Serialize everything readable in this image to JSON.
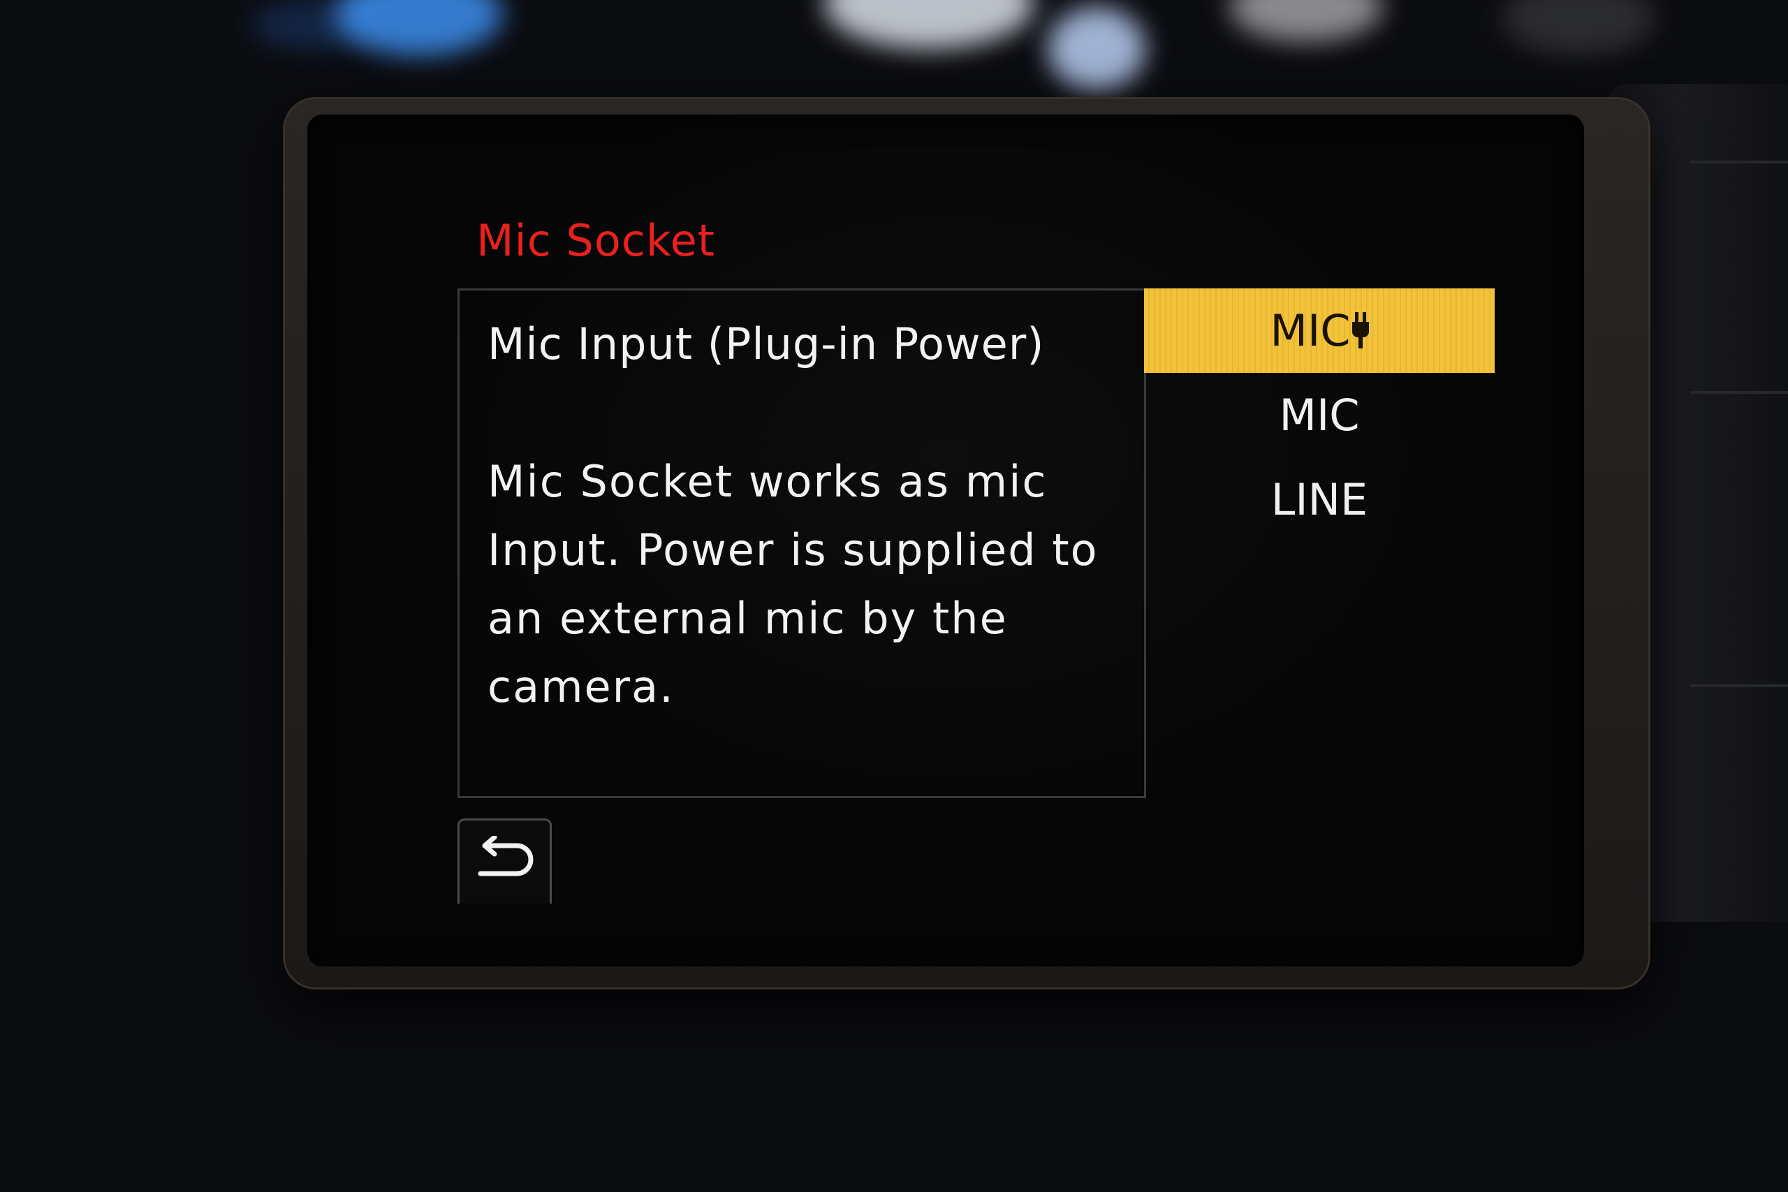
{
  "menu": {
    "title": "Mic Socket",
    "title_color": "#e8201e"
  },
  "description": {
    "heading": "Mic Input (Plug-in Power)",
    "body": "Mic Socket works as mic Input. Power is supplied to an external mic by the camera."
  },
  "options": [
    {
      "label": "MIC",
      "icon": "plug-icon",
      "selected": true
    },
    {
      "label": "MIC",
      "selected": false
    },
    {
      "label": "LINE",
      "selected": false
    }
  ],
  "colors": {
    "selection_highlight": "#f3c23b",
    "text": "#f2f2f2",
    "background": "#060607"
  },
  "back_button": {
    "icon": "return-arrow-icon"
  }
}
